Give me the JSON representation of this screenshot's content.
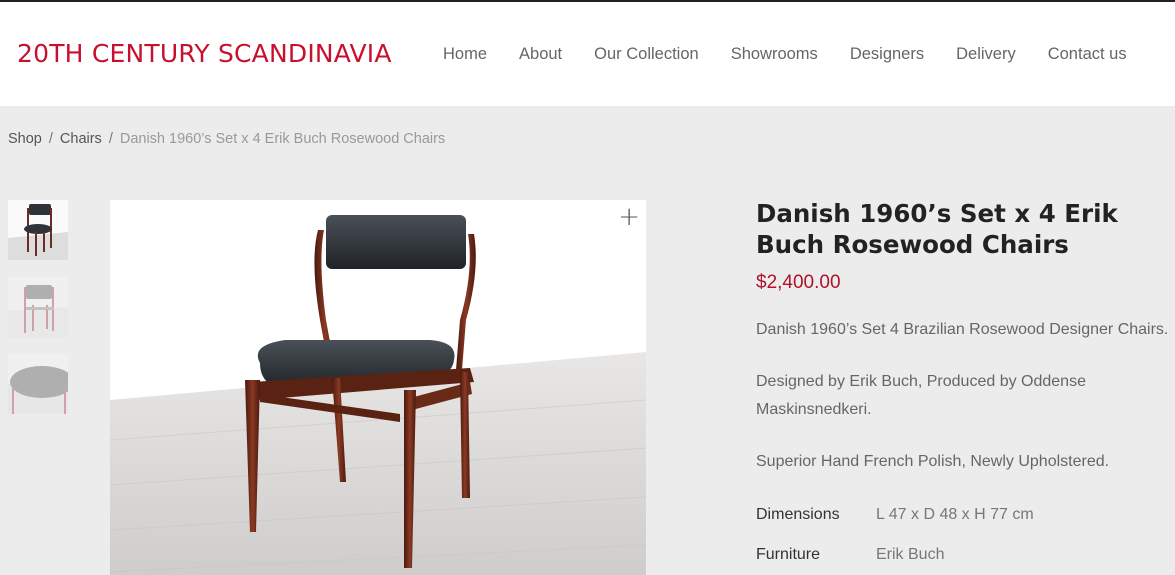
{
  "header": {
    "logo": "20TH CENTURY SCANDINAVIA",
    "nav": [
      "Home",
      "About",
      "Our Collection",
      "Showrooms",
      "Designers",
      "Delivery",
      "Contact us"
    ]
  },
  "breadcrumb": {
    "items": [
      "Shop",
      "Chairs"
    ],
    "current": "Danish 1960’s Set x 4 Erik Buch Rosewood Chairs"
  },
  "gallery": {
    "zoom_icon": "plus-icon",
    "thumbnails": 3
  },
  "product": {
    "title": "Danish 1960’s Set x 4 Erik Buch Rosewood Chairs",
    "price": "$2,400.00",
    "desc1": "Danish 1960’s Set 4 Brazilian Rosewood Designer Chairs.",
    "desc2": "Designed by Erik Buch, Produced by Oddense Maskinsnedkeri.",
    "desc3": "Superior Hand French Polish, Newly Upholstered.",
    "specs": [
      {
        "label": "Dimensions",
        "value": "L 47 x D 48 x H 77 cm"
      },
      {
        "label": "Furniture",
        "value": "Erik Buch"
      }
    ]
  },
  "colors": {
    "brand": "#c8102e",
    "price": "#b0122a",
    "background": "#ececec"
  }
}
